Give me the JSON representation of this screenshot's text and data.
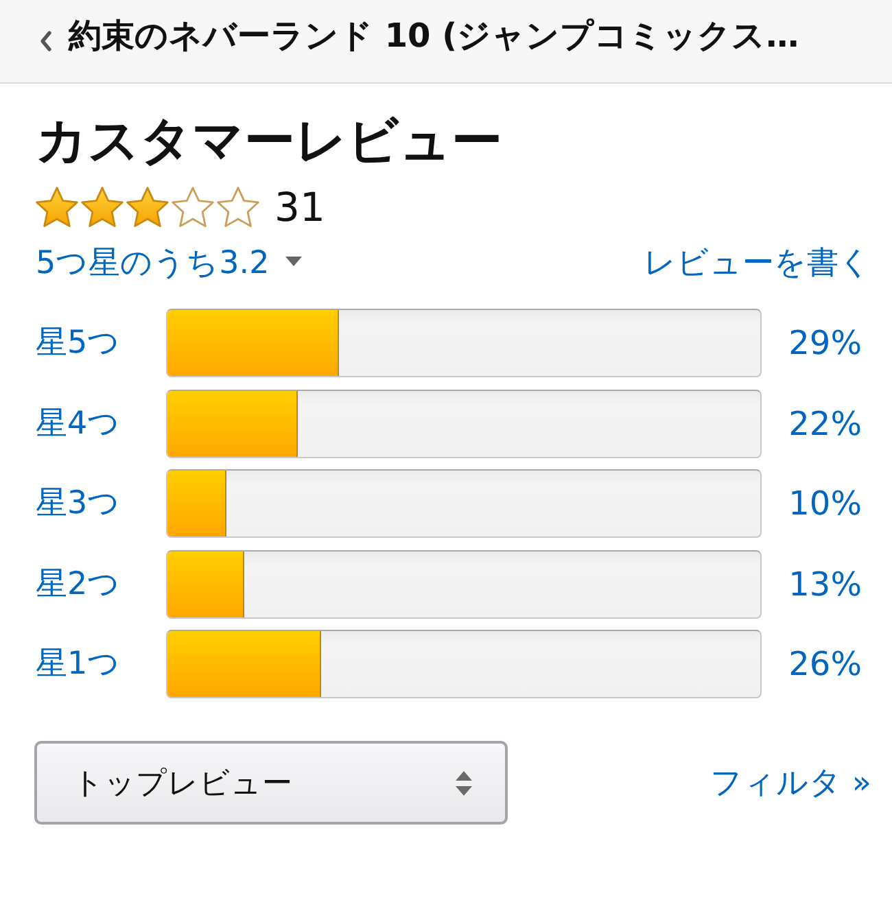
{
  "header": {
    "title": "約束のネバーランド 10 (ジャンプコミックス…"
  },
  "reviews": {
    "title": "カスタマーレビュー",
    "stars": 3,
    "count": "31",
    "average": "5つ星のうち3.2",
    "write_review": "レビューを書く"
  },
  "histogram": [
    {
      "label": "星5つ",
      "level": 0.29,
      "percent": "29%"
    },
    {
      "label": "星4つ",
      "level": 0.22,
      "percent": "22%"
    },
    {
      "label": "星3つ",
      "level": 0.1,
      "percent": "10%"
    },
    {
      "label": "星2つ",
      "level": 0.13,
      "percent": "13%"
    },
    {
      "label": "星1つ",
      "level": 0.26,
      "percent": "26%"
    }
  ],
  "sort": {
    "value": "トップレビュー"
  },
  "filter": {
    "label": "フィルタ »"
  }
}
